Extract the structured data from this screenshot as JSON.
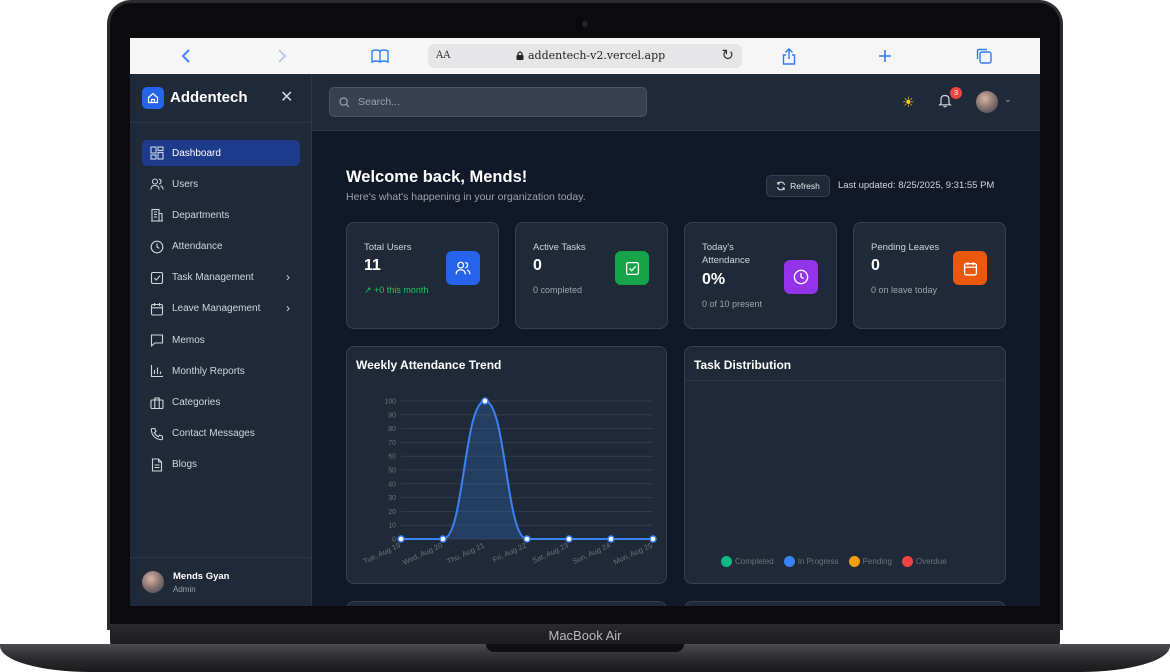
{
  "device": {
    "label": "MacBook Air"
  },
  "browser": {
    "url": "addentech-v2.vercel.app",
    "aa": "AA"
  },
  "sidebar": {
    "brand": "Addentech",
    "items": [
      {
        "label": "Dashboard",
        "icon": "grid-icon",
        "active": true
      },
      {
        "label": "Users",
        "icon": "users-icon"
      },
      {
        "label": "Departments",
        "icon": "building-icon"
      },
      {
        "label": "Attendance",
        "icon": "clock-icon"
      },
      {
        "label": "Task Management",
        "icon": "checkbox-icon",
        "chevron": true
      },
      {
        "label": "Leave Management",
        "icon": "calendar-icon",
        "chevron": true
      },
      {
        "label": "Memos",
        "icon": "message-icon"
      },
      {
        "label": "Monthly Reports",
        "icon": "bar-chart-icon"
      },
      {
        "label": "Categories",
        "icon": "briefcase-icon"
      },
      {
        "label": "Contact Messages",
        "icon": "phone-icon"
      },
      {
        "label": "Blogs",
        "icon": "document-icon"
      }
    ],
    "user": {
      "name": "Mends Gyan",
      "role": "Admin"
    }
  },
  "topbar": {
    "search_placeholder": "Search...",
    "notification_count": "3"
  },
  "header": {
    "title": "Welcome back, Mends!",
    "subtitle": "Here's what's happening in your organization today.",
    "refresh_label": "Refresh",
    "last_updated": "Last updated: 8/25/2025, 9:31:55 PM"
  },
  "stats": [
    {
      "label": "Total Users",
      "value": "11",
      "sub": "+0 this month",
      "color": "#2563eb",
      "icon": "users-icon"
    },
    {
      "label": "Active Tasks",
      "value": "0",
      "sub": "0 completed",
      "color": "#16a34a",
      "icon": "checkbox-icon"
    },
    {
      "label": "Today's Attendance",
      "value": "0%",
      "sub": "0 of 10 present",
      "color": "#9333ea",
      "icon": "clock-icon"
    },
    {
      "label": "Pending Leaves",
      "value": "0",
      "sub": "0 on leave today",
      "color": "#ea580c",
      "icon": "calendar-icon"
    }
  ],
  "attendance_card": {
    "title": "Weekly Attendance Trend"
  },
  "task_card": {
    "title": "Task Distribution",
    "legend": [
      {
        "label": "Completed",
        "color": "#10b981"
      },
      {
        "label": "In Progress",
        "color": "#3b82f6"
      },
      {
        "label": "Pending",
        "color": "#f59e0b"
      },
      {
        "label": "Overdue",
        "color": "#ef4444"
      }
    ]
  },
  "chart_data": {
    "type": "area",
    "title": "Weekly Attendance Trend",
    "categories": [
      "Tue, Aug 19",
      "Wed, Aug 20",
      "Thu, Aug 21",
      "Fri, Aug 22",
      "Sat, Aug 23",
      "Sun, Aug 24",
      "Mon, Aug 25"
    ],
    "series": [
      {
        "values": [
          0,
          0,
          100,
          0,
          0,
          0,
          0
        ]
      }
    ],
    "ylim": [
      0,
      100
    ],
    "yticks": [
      0,
      10,
      20,
      30,
      40,
      50,
      60,
      70,
      80,
      90,
      100
    ],
    "grid": true,
    "color": "#3b82f6"
  }
}
